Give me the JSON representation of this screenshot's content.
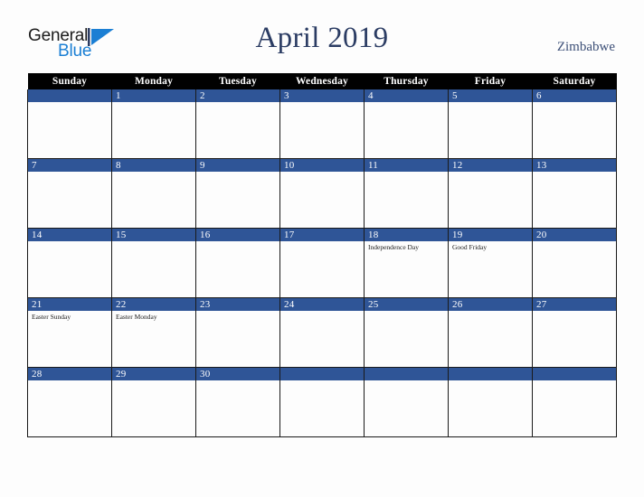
{
  "brand": {
    "name_part1": "General",
    "name_part2": "Blue",
    "triangle_color": "#1b7fd4"
  },
  "header": {
    "title": "April 2019",
    "country": "Zimbabwe"
  },
  "colors": {
    "header_row_bg": "#010101",
    "day_bar_bg": "#2f5597",
    "title_color": "#2b3c63",
    "country_color": "#3c4f77",
    "page_bg": "#fdfdfd",
    "grid_border": "#1a1a1a"
  },
  "weekday_headers": [
    "Sunday",
    "Monday",
    "Tuesday",
    "Wednesday",
    "Thursday",
    "Friday",
    "Saturday"
  ],
  "weeks": [
    [
      {
        "day": "",
        "events": []
      },
      {
        "day": "1",
        "events": []
      },
      {
        "day": "2",
        "events": []
      },
      {
        "day": "3",
        "events": []
      },
      {
        "day": "4",
        "events": []
      },
      {
        "day": "5",
        "events": []
      },
      {
        "day": "6",
        "events": []
      }
    ],
    [
      {
        "day": "7",
        "events": []
      },
      {
        "day": "8",
        "events": []
      },
      {
        "day": "9",
        "events": []
      },
      {
        "day": "10",
        "events": []
      },
      {
        "day": "11",
        "events": []
      },
      {
        "day": "12",
        "events": []
      },
      {
        "day": "13",
        "events": []
      }
    ],
    [
      {
        "day": "14",
        "events": []
      },
      {
        "day": "15",
        "events": []
      },
      {
        "day": "16",
        "events": []
      },
      {
        "day": "17",
        "events": []
      },
      {
        "day": "18",
        "events": [
          "Independence Day"
        ]
      },
      {
        "day": "19",
        "events": [
          "Good Friday"
        ]
      },
      {
        "day": "20",
        "events": []
      }
    ],
    [
      {
        "day": "21",
        "events": [
          "Easter Sunday"
        ]
      },
      {
        "day": "22",
        "events": [
          "Easter Monday"
        ]
      },
      {
        "day": "23",
        "events": []
      },
      {
        "day": "24",
        "events": []
      },
      {
        "day": "25",
        "events": []
      },
      {
        "day": "26",
        "events": []
      },
      {
        "day": "27",
        "events": []
      }
    ],
    [
      {
        "day": "28",
        "events": []
      },
      {
        "day": "29",
        "events": []
      },
      {
        "day": "30",
        "events": []
      },
      {
        "day": "",
        "events": []
      },
      {
        "day": "",
        "events": []
      },
      {
        "day": "",
        "events": []
      },
      {
        "day": "",
        "events": []
      }
    ]
  ]
}
